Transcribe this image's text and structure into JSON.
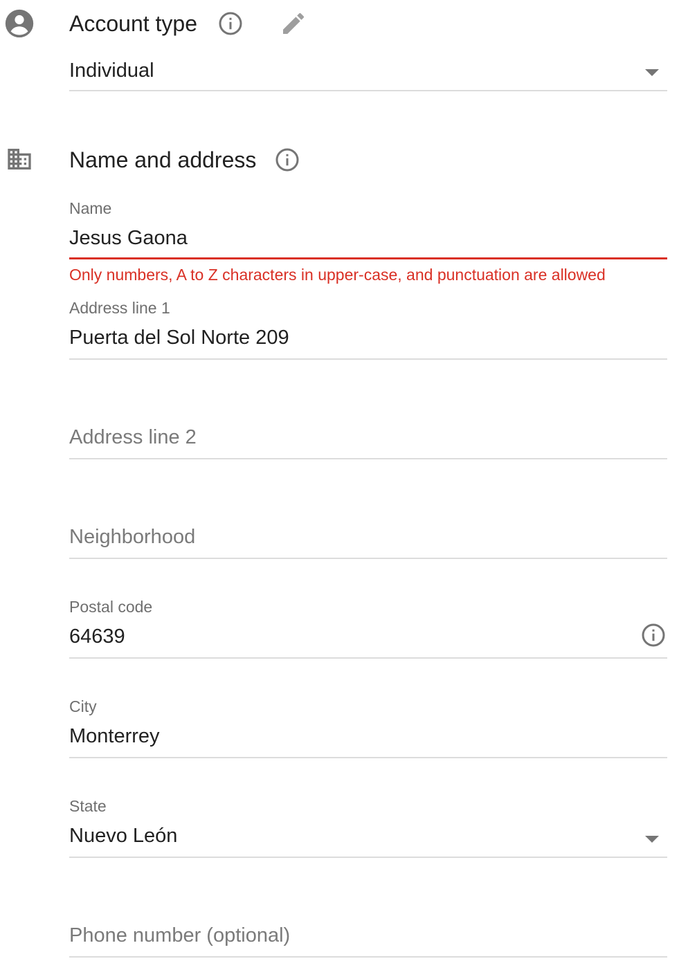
{
  "account_type": {
    "title": "Account type",
    "icon": "account-circle-icon",
    "selected": "Individual"
  },
  "name_address": {
    "title": "Name and address",
    "icon": "business-building-icon"
  },
  "fields": {
    "name": {
      "label": "Name",
      "value": "Jesus Gaona",
      "error": "Only numbers, A to Z characters in upper-case, and punctuation are allowed"
    },
    "address1": {
      "label": "Address line 1",
      "value": "Puerta del Sol Norte 209"
    },
    "address2": {
      "placeholder": "Address line 2"
    },
    "neighborhood": {
      "placeholder": "Neighborhood"
    },
    "postal_code": {
      "label": "Postal code",
      "value": "64639"
    },
    "city": {
      "label": "City",
      "value": "Monterrey"
    },
    "state": {
      "label": "State",
      "value": "Nuevo León"
    },
    "phone": {
      "placeholder": "Phone number (optional)"
    }
  },
  "colors": {
    "error": "#d93025",
    "icon_gray": "#757575",
    "text": "#212121",
    "label": "#6f6f6f",
    "divider": "#dcdcdc"
  }
}
